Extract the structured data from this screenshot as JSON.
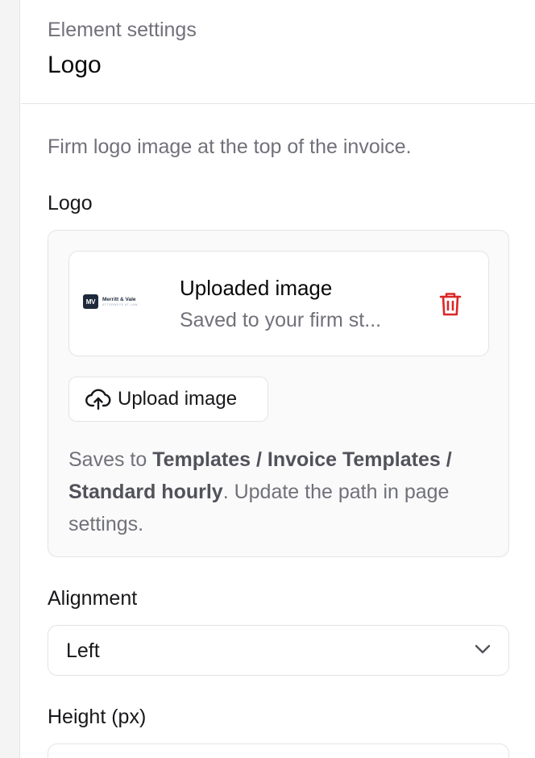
{
  "header": {
    "eyebrow": "Element settings",
    "title": "Logo"
  },
  "description": "Firm logo image at the top of the invoice.",
  "logo_field": {
    "label": "Logo",
    "image_card": {
      "thumbnail_mark": "MV",
      "thumbnail_name": "Merritt & Vale",
      "thumbnail_sub": "ATTORNEYS AT LAW",
      "title": "Uploaded image",
      "subtitle": "Saved to your firm st...",
      "delete_icon": "trash-icon"
    },
    "upload_button": {
      "icon": "cloud-upload-icon",
      "label": "Upload image"
    },
    "help": {
      "prefix": "Saves to ",
      "path": "Templates / Invoice Templates / Standard hourly",
      "suffix": ". Update the path in page settings."
    }
  },
  "alignment": {
    "label": "Alignment",
    "value": "Left",
    "icon": "chevron-down-icon"
  },
  "height": {
    "label": "Height (px)",
    "value": ""
  },
  "colors": {
    "danger": "#dc2626",
    "border": "#e4e4e7",
    "muted_text": "#71717a"
  }
}
